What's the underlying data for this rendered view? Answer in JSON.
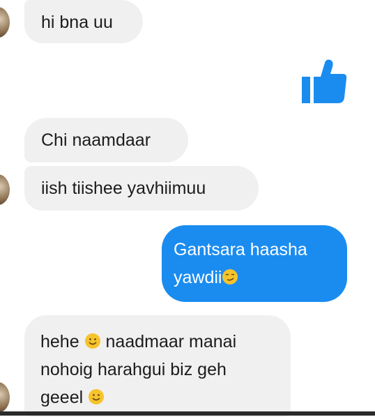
{
  "messages": [
    {
      "text": "hi bna uu"
    },
    {
      "text": "Chi naamdaar"
    },
    {
      "text": "iish tiishee yavhiimuu"
    },
    {
      "line1": "Gantsara haasha",
      "line2": "yawdii"
    },
    {
      "line1a": "hehe",
      "line1b": "naadmaar manai",
      "line2": "nohoig harahgui biz geh",
      "line3": "geeel"
    }
  ],
  "icons": {
    "like": "thumbs-up-icon",
    "smile": "slightly-smiling-face-icon",
    "smirk": "smirking-face-icon"
  },
  "colors": {
    "outgoing_bubble": "#1a8cf0",
    "incoming_bubble": "#f0f0f0",
    "like_icon": "#1a8cf0"
  }
}
